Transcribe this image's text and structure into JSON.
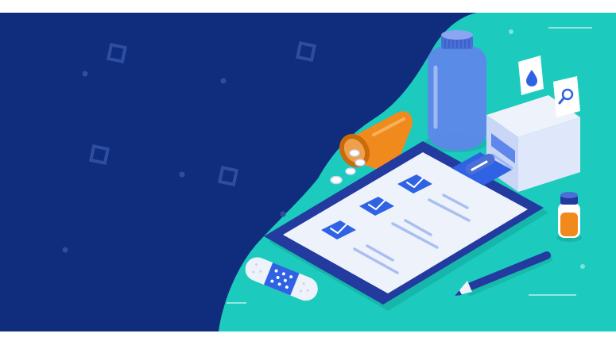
{
  "scene": {
    "palette": {
      "navy": "#102c7c",
      "teal": "#1ccbbd",
      "teal_dark": "#13a89b",
      "clipboard": "#233a9e",
      "paper": "#eef2fb",
      "check_blue": "#2f63e4",
      "line_blue": "#a9bff0",
      "orange": "#f08a1c",
      "bottle_blue": "#5f86ea",
      "white": "#ffffff"
    },
    "icons": [
      "water-drop-icon",
      "magnifier-icon",
      "checkmark-icon",
      "bandage-icon",
      "pill-icon",
      "pen-icon"
    ],
    "checklist_items_checked": 3
  }
}
